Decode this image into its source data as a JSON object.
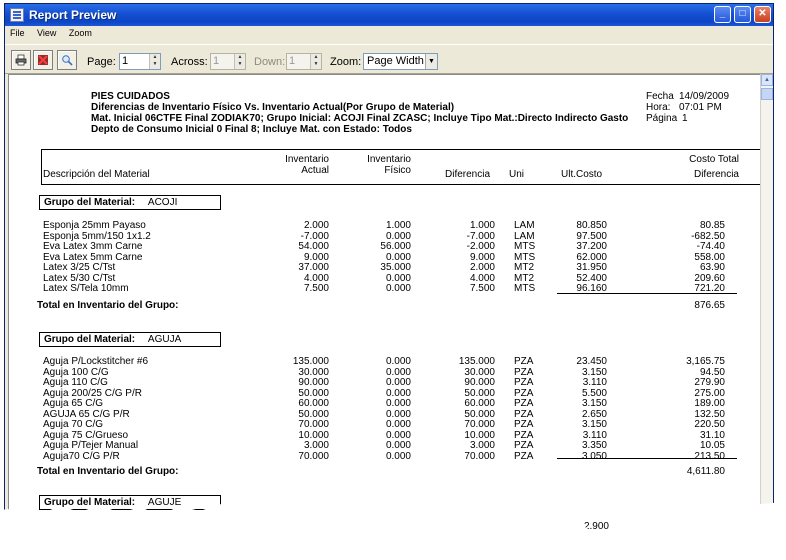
{
  "window": {
    "title": "Report Preview"
  },
  "menu": [
    "File",
    "View",
    "Zoom"
  ],
  "toolbar": {
    "page_label": "Page:",
    "page_value": "1",
    "across_label": "Across:",
    "across_value": "1",
    "down_label": "Down:",
    "down_value": "1",
    "zoom_label": "Zoom:",
    "zoom_value": "Page Width"
  },
  "report": {
    "company": "PIES CUIDADOS",
    "title": "Diferencias de Inventario Físico Vs. Inventario Actual(Por Grupo de Material)",
    "filters1": "Mat. Inicial 06CTFE Final ZODIAK70;   Grupo Inicial: ACOJI Final ZCASC;   Incluye Tipo Mat.:Directo Indirecto Gasto",
    "filters2": "Depto de Consumo Inicial 0 Final 8;   Incluye Mat. con Estado: Todos",
    "fecha_label": "Fecha",
    "fecha": "14/09/2009",
    "hora_label": "Hora:",
    "hora": "07:01 PM",
    "pagina_label": "Página",
    "pagina": "1",
    "columns": {
      "desc": "Descripción del Material",
      "inv_actual_1": "Inventario",
      "inv_actual_2": "Actual",
      "inv_fisico_1": "Inventario",
      "inv_fisico_2": "Físico",
      "diferencia": "Diferencia",
      "uni": "Uni",
      "ult_costo": "Ult.Costo",
      "costo_total_1": "Costo Total",
      "costo_total_2": "Diferencia"
    },
    "group_label": "Grupo del Material:",
    "total_label": "Total en Inventario del Grupo:",
    "groups": [
      {
        "name": "ACOJI",
        "rows": [
          [
            "Esponja 25mm Payaso",
            "2.000",
            "1.000",
            "1.000",
            "LAM",
            "80.850",
            "80.85"
          ],
          [
            "Esponja 5mm/150  1x1.2",
            "-7.000",
            "0.000",
            "-7.000",
            "LAM",
            "97.500",
            "-682.50"
          ],
          [
            "Eva Latex 3mm Carne",
            "54.000",
            "56.000",
            "-2.000",
            "MTS",
            "37.200",
            "-74.40"
          ],
          [
            "Eva Latex 5mm Carne",
            "9.000",
            "0.000",
            "9.000",
            "MTS",
            "62.000",
            "558.00"
          ],
          [
            "Latex 3/25 C/Tst",
            "37.000",
            "35.000",
            "2.000",
            "MT2",
            "31.950",
            "63.90"
          ],
          [
            "Latex 5/30 C/Tst",
            "4.000",
            "0.000",
            "4.000",
            "MT2",
            "52.400",
            "209.60"
          ],
          [
            "Latex S/Tela 10mm",
            "7.500",
            "0.000",
            "7.500",
            "MTS",
            "96.160",
            "721.20"
          ]
        ],
        "total": "876.65"
      },
      {
        "name": "AGUJA",
        "rows": [
          [
            "Aguja  P/Lockstitcher #6",
            "135.000",
            "0.000",
            "135.000",
            "PZA",
            "23.450",
            "3,165.75"
          ],
          [
            "Aguja 100 C/G",
            "30.000",
            "0.000",
            "30.000",
            "PZA",
            "3.150",
            "94.50"
          ],
          [
            "Aguja 110 C/G",
            "90.000",
            "0.000",
            "90.000",
            "PZA",
            "3.110",
            "279.90"
          ],
          [
            "Aguja 200/25 C/G P/R",
            "50.000",
            "0.000",
            "50.000",
            "PZA",
            "5.500",
            "275.00"
          ],
          [
            "Aguja 65 C/G",
            "60.000",
            "0.000",
            "60.000",
            "PZA",
            "3.150",
            "189.00"
          ],
          [
            "AGUJA 65 C/G P/R",
            "50.000",
            "0.000",
            "50.000",
            "PZA",
            "2.650",
            "132.50"
          ],
          [
            "Aguja 70 C/G",
            "70.000",
            "0.000",
            "70.000",
            "PZA",
            "3.150",
            "220.50"
          ],
          [
            "Aguja 75 C/Grueso",
            "10.000",
            "0.000",
            "10.000",
            "PZA",
            "3.110",
            "31.10"
          ],
          [
            "Aguja P/Tejer Manual",
            "3.000",
            "0.000",
            "3.000",
            "PZA",
            "3.350",
            "10.05"
          ],
          [
            "Aguja70 C/G P/R",
            "70.000",
            "0.000",
            "70.000",
            "PZA",
            "3.050",
            "213.50"
          ]
        ],
        "total": "4,611.80"
      },
      {
        "name": "AGUJE",
        "rows": [],
        "total": ""
      }
    ],
    "cut_value": "2.900"
  }
}
